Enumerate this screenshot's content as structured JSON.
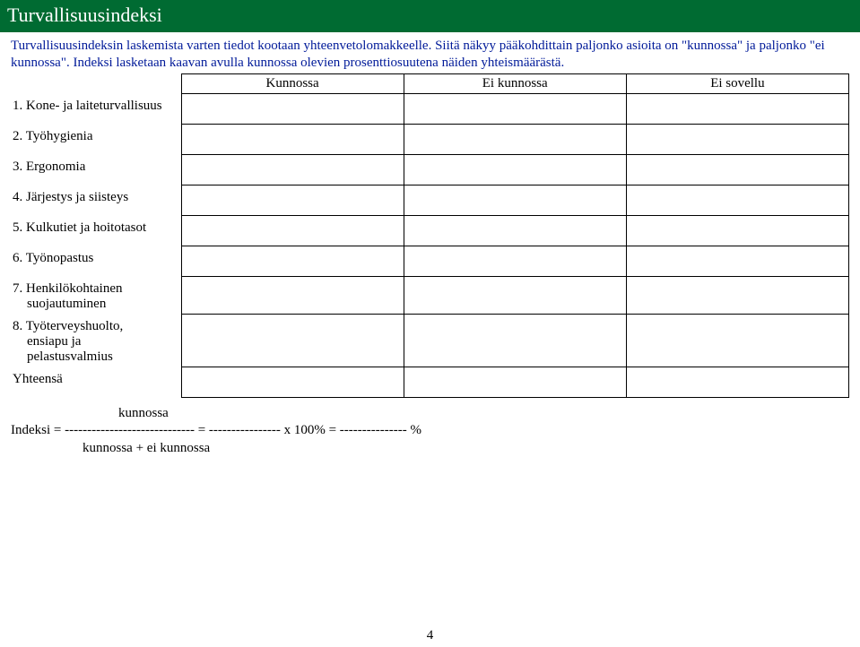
{
  "header": {
    "title": "Turvallisuusindeksi"
  },
  "intro": {
    "text": "Turvallisuusindeksin laskemista varten tiedot kootaan yhteenvetolomakkeelle. Siitä näkyy pääkohdittain paljonko asioita on \"kunnossa\" ja paljonko \"ei kunnossa\". Indeksi lasketaan kaavan avulla kunnossa olevien prosenttiosuutena näiden yhteismäärästä."
  },
  "table": {
    "headers": {
      "col1": "Kunnossa",
      "col2": "Ei kunnossa",
      "col3": "Ei sovellu"
    },
    "rows": [
      {
        "label": "1. Kone- ja laiteturvallisuus",
        "v1": "",
        "v2": "",
        "v3": ""
      },
      {
        "label": "2. Työhygienia",
        "v1": "",
        "v2": "",
        "v3": ""
      },
      {
        "label": "3. Ergonomia",
        "v1": "",
        "v2": "",
        "v3": ""
      },
      {
        "label": "4. Järjestys ja siisteys",
        "v1": "",
        "v2": "",
        "v3": ""
      },
      {
        "label": "5. Kulkutiet ja hoitotasot",
        "v1": "",
        "v2": "",
        "v3": ""
      },
      {
        "label": "6. Työnopastus",
        "v1": "",
        "v2": "",
        "v3": ""
      },
      {
        "label": "7. Henkilökohtainen",
        "label2": "suojautuminen",
        "v1": "",
        "v2": "",
        "v3": ""
      },
      {
        "label": "8. Työterveyshuolto,",
        "label2": "ensiapu ja",
        "label3": "pelastusvalmius",
        "v1": "",
        "v2": "",
        "v3": ""
      }
    ],
    "total": {
      "label": "Yhteensä",
      "v1": "",
      "v2": "",
      "v3": ""
    }
  },
  "formula": {
    "top": "kunnossa",
    "mid": "Indeksi = -----------------------------   = ----------------  x  100%    = ---------------  %",
    "bot": "kunnossa + ei kunnossa"
  },
  "page": {
    "number": "4"
  }
}
